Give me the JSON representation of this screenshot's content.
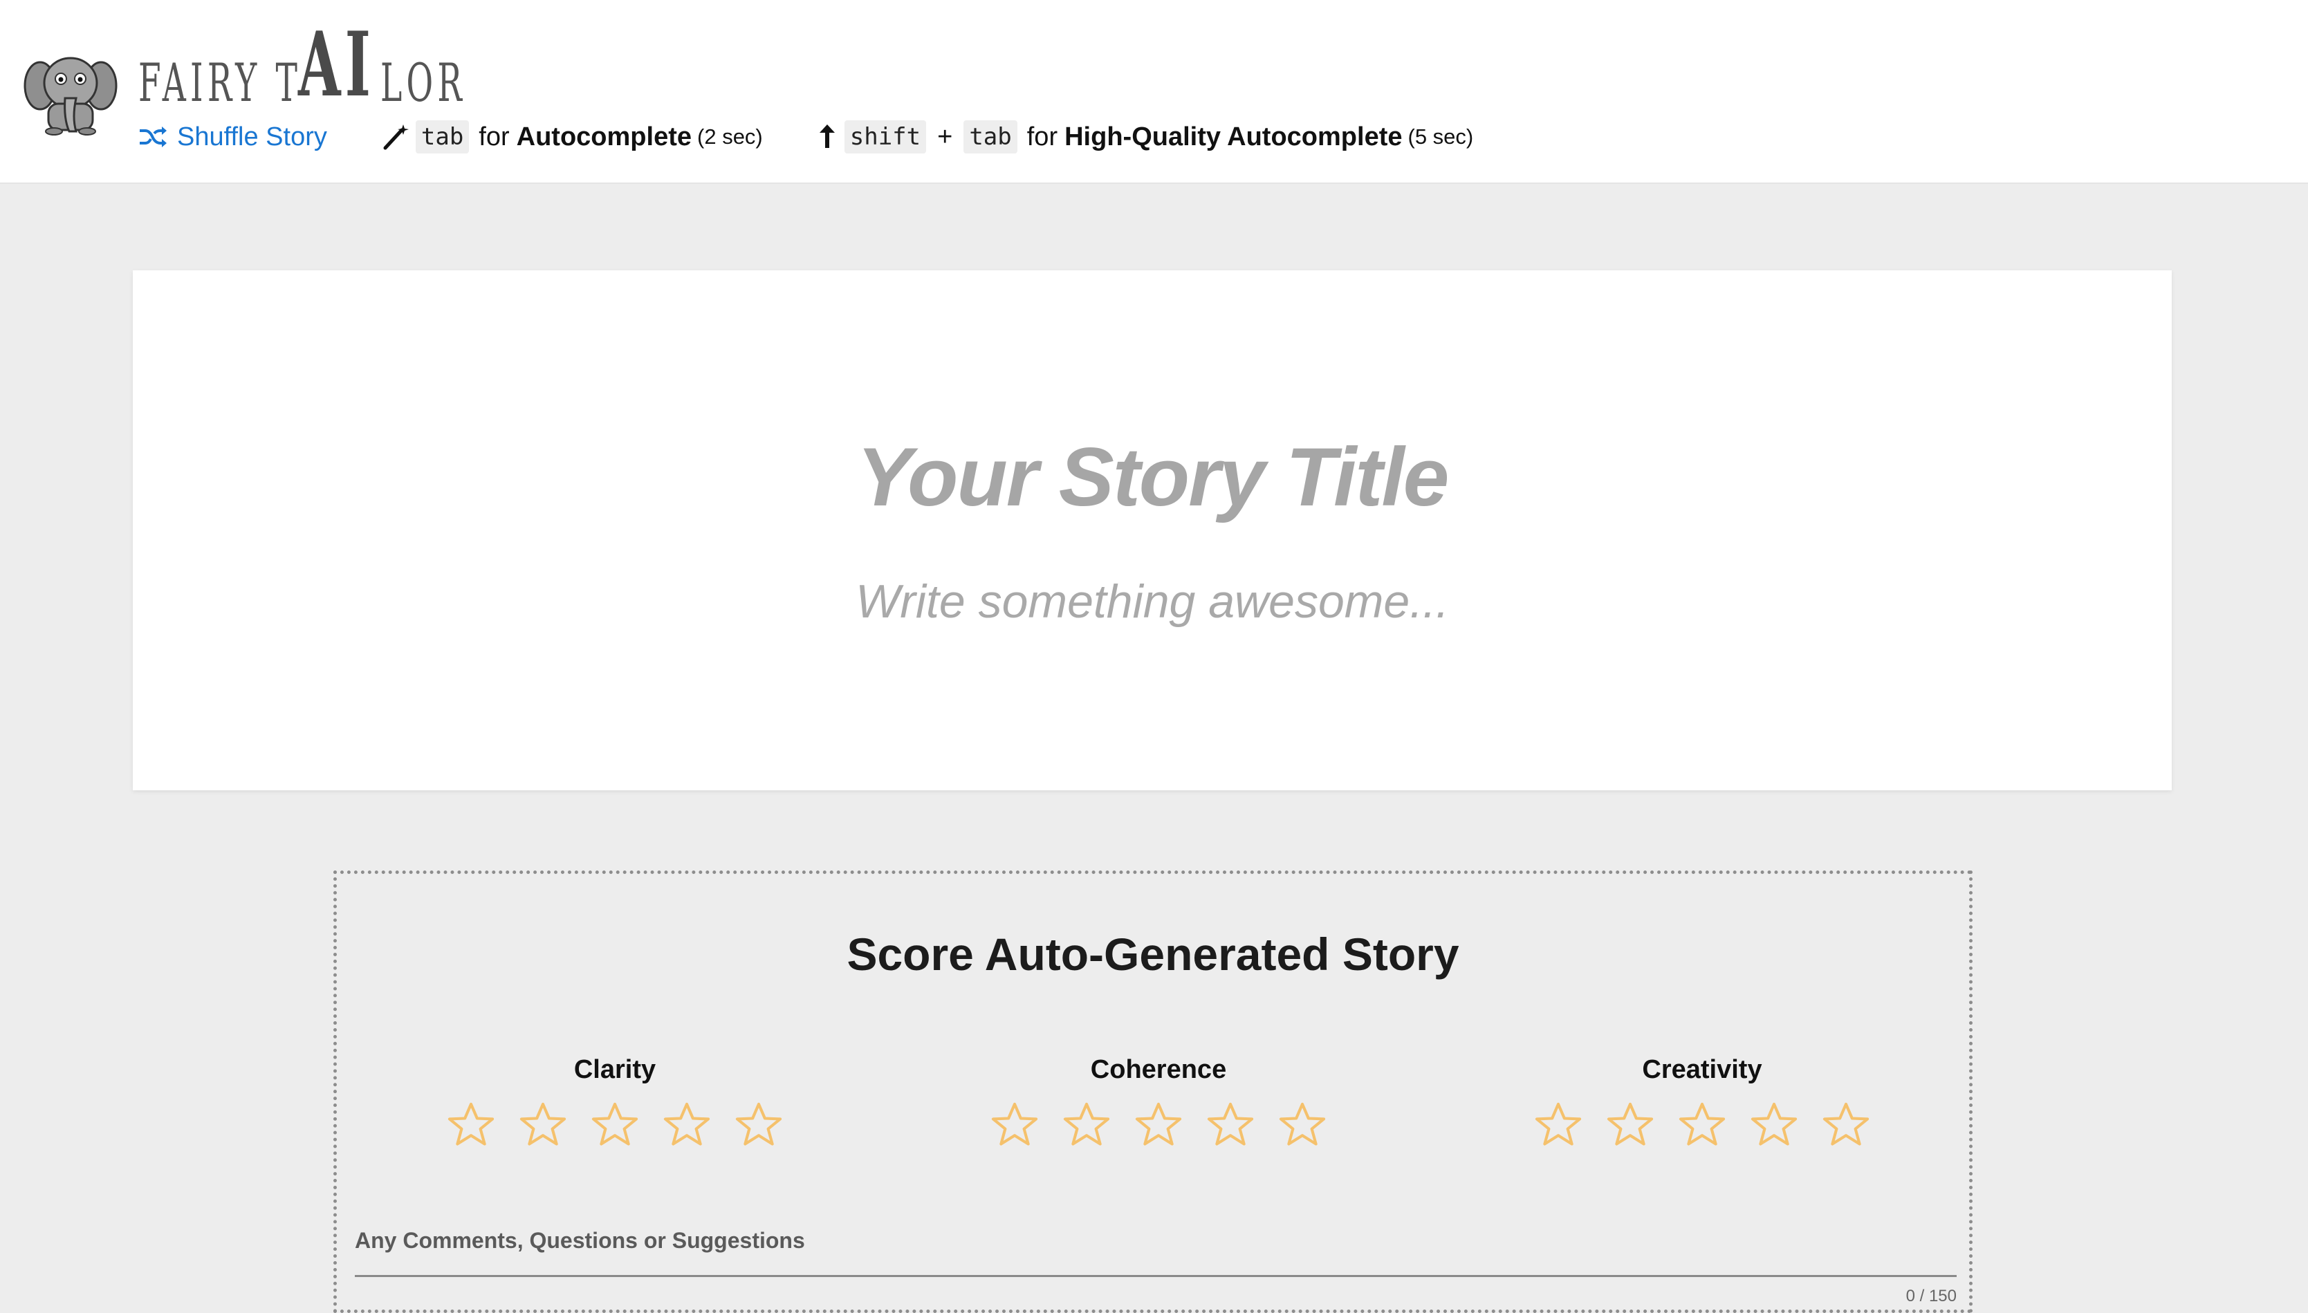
{
  "brand": {
    "logo_alt": "elephant-logo",
    "name_part1": "FAIRY T",
    "name_ai": "AI",
    "name_part2": "LOR"
  },
  "toolbar": {
    "shuffle_label": "Shuffle Story",
    "autocomplete_key": "tab",
    "autocomplete_for": "for",
    "autocomplete_label": "Autocomplete",
    "autocomplete_time": "(2 sec)",
    "hq_key1": "shift",
    "hq_plus": "+",
    "hq_key2": "tab",
    "hq_for": "for",
    "hq_label": "High-Quality Autocomplete",
    "hq_time": "(5 sec)"
  },
  "editor": {
    "title_placeholder": "Your Story Title",
    "body_placeholder": "Write something awesome..."
  },
  "score": {
    "heading": "Score Auto-Generated Story",
    "criteria": [
      {
        "label": "Clarity",
        "rating": 0,
        "max": 5
      },
      {
        "label": "Coherence",
        "rating": 0,
        "max": 5
      },
      {
        "label": "Creativity",
        "rating": 0,
        "max": 5
      }
    ],
    "comments_label": "Any Comments, Questions or Suggestions",
    "comments_value": "",
    "counter": "0 / 150"
  },
  "colors": {
    "accent": "#1976d2",
    "star": "#f5c16c",
    "background": "#ededed"
  }
}
